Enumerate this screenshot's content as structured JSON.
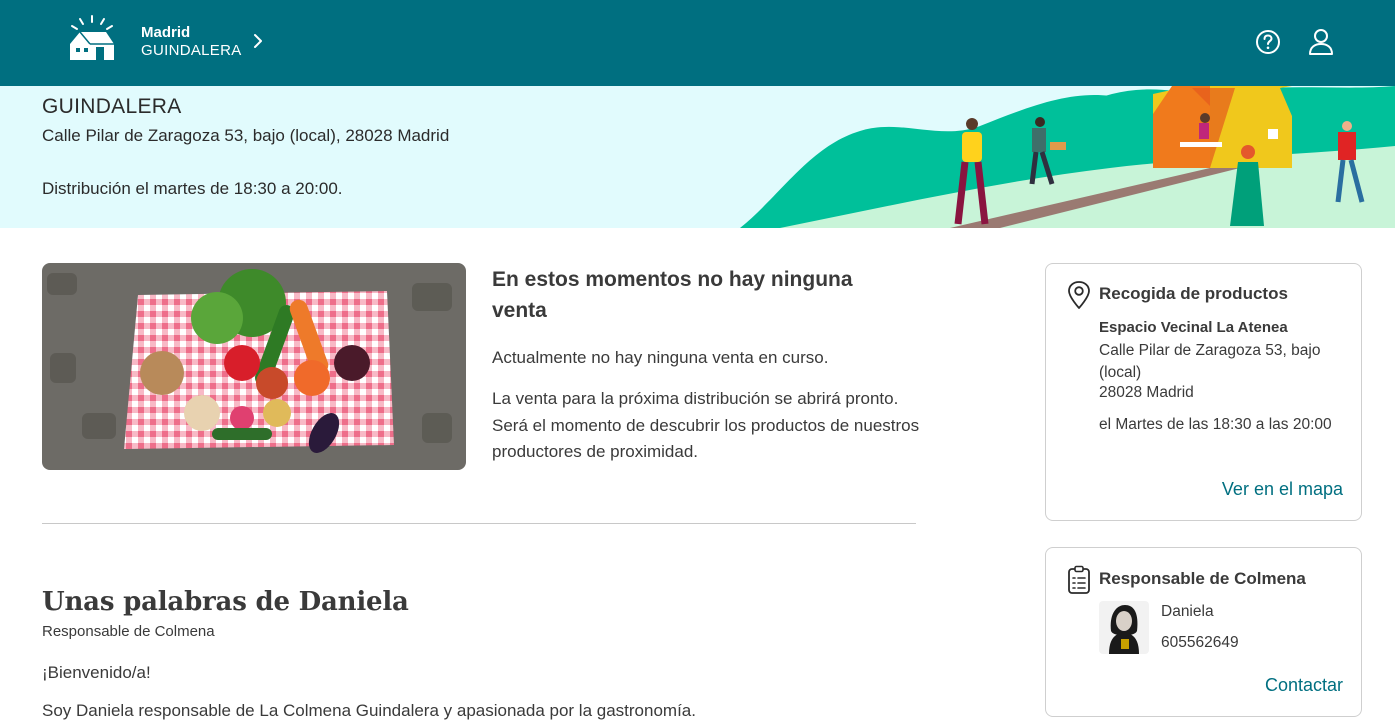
{
  "header": {
    "city": "Madrid",
    "hive_name": "GUINDALERA",
    "icons": {
      "logo": "hive-house-logo",
      "chevron": "chevron-right-icon",
      "help": "help-circle-icon",
      "account": "user-account-icon"
    },
    "colors": {
      "bar": "#006f80",
      "text": "#ffffff"
    }
  },
  "banner": {
    "title": "GUINDALERA",
    "address": "Calle Pilar de Zaragoza 53, bajo (local), 28028 Madrid",
    "distribution": "Distribución el martes de 18:30 a 20:00.",
    "colors": {
      "background": "#e1fbfd",
      "hills": "#00c09a",
      "tent": "#f0c81c"
    }
  },
  "sale": {
    "title": "En estos momentos no hay ninguna venta",
    "status": "Actualmente no hay ninguna venta en curso.",
    "next": "La venta para la próxima distribución se abrirá pronto. Será el momento de descubrir los productos de nuestros productores de proximidad."
  },
  "words": {
    "title": "Unas palabras de Daniela",
    "role": "Responsable de Colmena",
    "greeting": "¡Bienvenido/a!",
    "intro": "Soy Daniela responsable de La Colmena Guindalera y apasionada por la gastronomía."
  },
  "pickup_card": {
    "title": "Recogida de productos",
    "icon": "map-pin-icon",
    "venue": "Espacio Vecinal La Atenea",
    "street": "Calle Pilar de Zaragoza 53, bajo (local)",
    "postcode": "28028 Madrid",
    "schedule": "el Martes de las 18:30 a las 20:00",
    "link": "Ver en el mapa"
  },
  "manager_card": {
    "title": "Responsable de Colmena",
    "icon": "clipboard-list-icon",
    "name": "Daniela",
    "phone": "605562649",
    "link": "Contactar"
  },
  "accent_color": "#006f80"
}
